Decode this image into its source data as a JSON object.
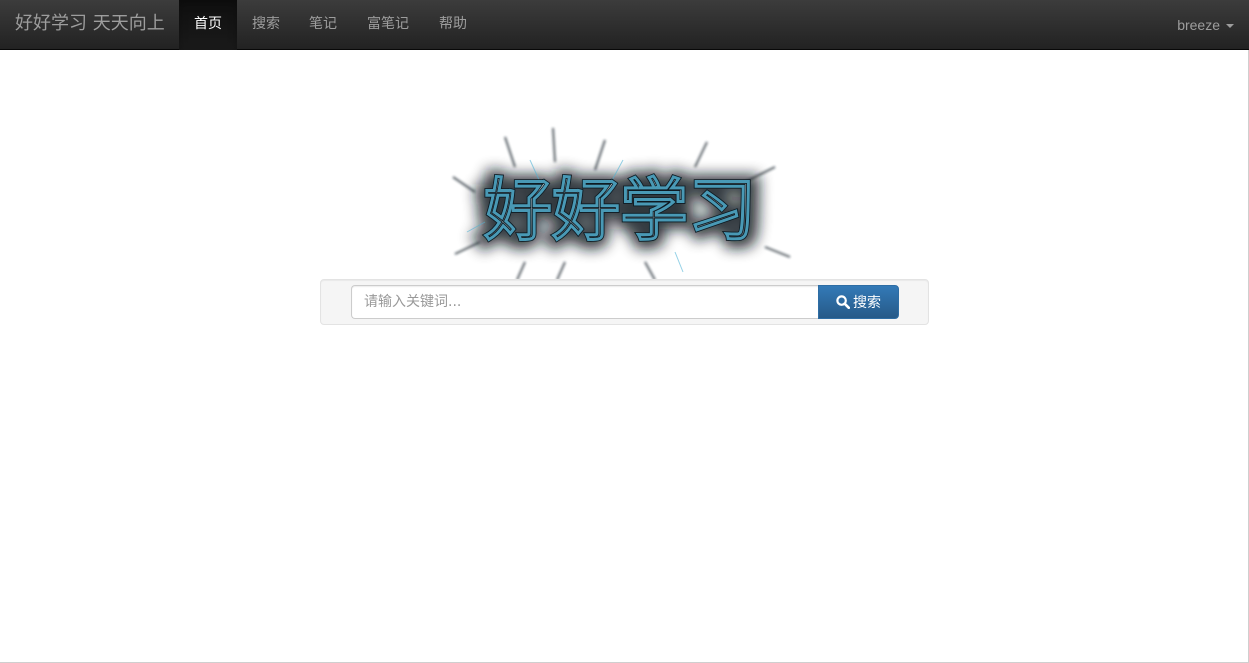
{
  "navbar": {
    "brand": "好好学习 天天向上",
    "items": [
      {
        "label": "首页",
        "active": true
      },
      {
        "label": "搜索",
        "active": false
      },
      {
        "label": "笔记",
        "active": false
      },
      {
        "label": "富笔记",
        "active": false
      },
      {
        "label": "帮助",
        "active": false
      }
    ],
    "user": {
      "label": "breeze",
      "icon": "caret-down-icon"
    }
  },
  "logo": {
    "text": "好好学习"
  },
  "search": {
    "placeholder": "请输入关键词...",
    "value": "",
    "button_label": "搜索",
    "button_icon": "search-icon"
  },
  "colors": {
    "navbar_bg": "#222222",
    "nav_text": "#9d9d9d",
    "nav_active_text": "#ffffff",
    "primary": "#337ab7",
    "well_bg": "#f5f5f5"
  }
}
